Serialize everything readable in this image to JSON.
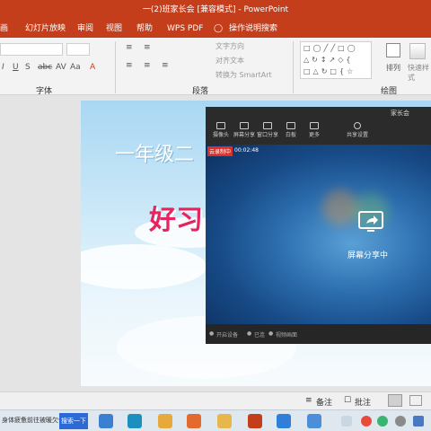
{
  "window": {
    "title": "一(2)班家长会 [兼容模式] - PowerPoint"
  },
  "tabs": [
    "画",
    "幻灯片放映",
    "审阅",
    "视图",
    "帮助",
    "WPS PDF",
    "操作说明搜索"
  ],
  "ribbon": {
    "font_group_label": "字体",
    "paragraph_group_label": "段落",
    "drawing_group_label": "绘图",
    "text_direction": "文字方向",
    "align_text": "对齐文本",
    "convert_smartart": "转换为 SmartArt",
    "arrange_label": "排列",
    "quick_styles_label": "快速样式"
  },
  "slide": {
    "heading": "一年级二",
    "big_text": "好习"
  },
  "meeting": {
    "title": "家长会",
    "tools": [
      "摄像头",
      "屏幕分享",
      "窗口分享",
      "白板",
      "更多",
      "共享设置"
    ],
    "rec_badge": "云录制中",
    "timer": "00:02:48",
    "share_status": "屏幕分享中",
    "footer": [
      "开启设备",
      "已连",
      "视频画面"
    ]
  },
  "statusbar": {
    "notes": "备注",
    "comments": "批注"
  },
  "taskbar": {
    "weather": "身体疲惫前往被暖欠债",
    "search_label": "搜索一下"
  },
  "colors": {
    "accent": "#c43e1c",
    "share_blue": "#2d6fb0"
  }
}
